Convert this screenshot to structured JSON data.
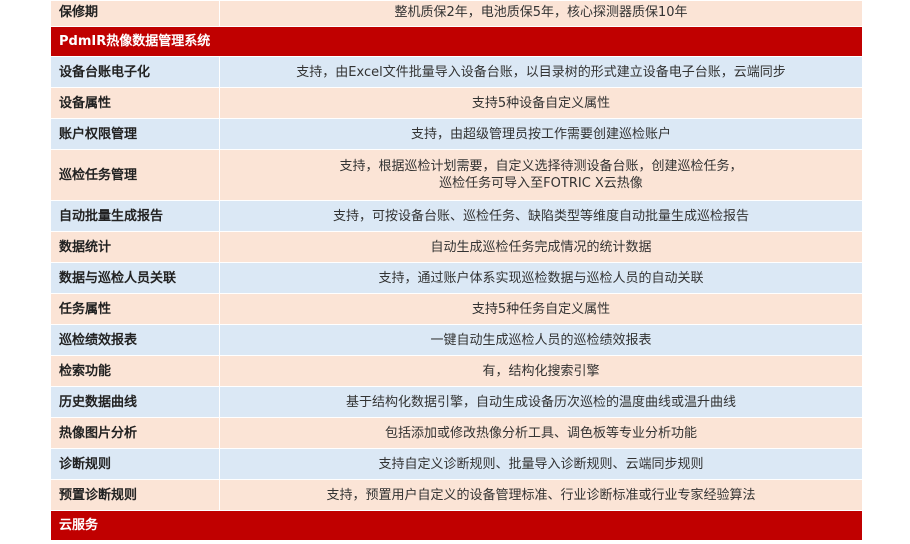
{
  "rows_top": [
    {
      "label": "保修期",
      "value": "整机质保2年，电池质保5年，核心探测器质保10年"
    }
  ],
  "section1": {
    "title": "PdmIR热像数据管理系统"
  },
  "rows": [
    {
      "label": "设备台账电子化",
      "value": "支持，由Excel文件批量导入设备台账，以目录树的形式建立设备电子台账，云端同步"
    },
    {
      "label": "设备属性",
      "value": "支持5种设备自定义属性"
    },
    {
      "label": "账户权限管理",
      "value": "支持，由超级管理员按工作需要创建巡检账户"
    },
    {
      "label": "巡检任务管理",
      "value_line1": "支持，根据巡检计划需要，自定义选择待测设备台账，创建巡检任务，",
      "value_line2": "巡检任务可导入至FOTRIC X云热像"
    },
    {
      "label": "自动批量生成报告",
      "value": "支持，可按设备台账、巡检任务、缺陷类型等维度自动批量生成巡检报告"
    },
    {
      "label": "数据统计",
      "value": "自动生成巡检任务完成情况的统计数据"
    },
    {
      "label": "数据与巡检人员关联",
      "value": "支持，通过账户体系实现巡检数据与巡检人员的自动关联"
    },
    {
      "label": "任务属性",
      "value": "支持5种任务自定义属性"
    },
    {
      "label": "巡检绩效报表",
      "value": "一键自动生成巡检人员的巡检绩效报表"
    },
    {
      "label": "检索功能",
      "value": "有，结构化搜索引擎"
    },
    {
      "label": "历史数据曲线",
      "value": "基于结构化数据引擎，自动生成设备历次巡检的温度曲线或温升曲线"
    },
    {
      "label": "热像图片分析",
      "value": "包括添加或修改热像分析工具、调色板等专业分析功能"
    },
    {
      "label": "诊断规则",
      "value": "支持自定义诊断规则、批量导入诊断规则、云端同步规则"
    },
    {
      "label": "预置诊断规则",
      "value": "支持，预置用户自定义的设备管理标准、行业诊断标准或行业专家经验算法"
    }
  ],
  "section2": {
    "title": "云服务"
  }
}
